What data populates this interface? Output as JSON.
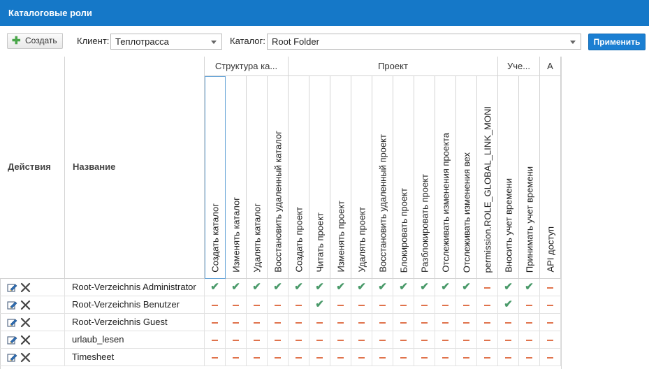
{
  "title": "Каталоговые роли",
  "toolbar": {
    "create_label": "Создать",
    "client_label": "Клиент:",
    "client_value": "Теплотрасса",
    "catalog_label": "Каталог:",
    "catalog_value": "Root Folder",
    "apply_label": "Применить"
  },
  "headers": {
    "actions": "Действия",
    "name": "Название",
    "groups": [
      "Структура ка...",
      "Проект",
      "Уче...",
      "A"
    ],
    "columns": [
      "Создать каталог",
      "Изменять каталог",
      "Удалять каталог",
      "Восстановить удаленный каталог",
      "Создать проект",
      "Читать проект",
      "Изменять проект",
      "Удалять проект",
      "Восстановить удаленный проект",
      "Блокировать проект",
      "Разблокировать проект",
      "Отслеживать изменения проекта",
      "Отслеживать изменения вех",
      "permission.ROLE_GLOBAL_LINK_MONI",
      "Вносить учет времени",
      "Принимать учет времени",
      "API доступ"
    ]
  },
  "rows": [
    {
      "name": "Root-Verzeichnis Administrator",
      "perms": [
        1,
        1,
        1,
        1,
        1,
        1,
        1,
        1,
        1,
        1,
        1,
        1,
        1,
        0,
        1,
        1,
        0
      ]
    },
    {
      "name": "Root-Verzeichnis Benutzer",
      "perms": [
        0,
        0,
        0,
        0,
        0,
        1,
        0,
        0,
        0,
        0,
        0,
        0,
        0,
        0,
        1,
        0,
        0
      ]
    },
    {
      "name": "Root-Verzeichnis Guest",
      "perms": [
        0,
        0,
        0,
        0,
        0,
        0,
        0,
        0,
        0,
        0,
        0,
        0,
        0,
        0,
        0,
        0,
        0
      ]
    },
    {
      "name": "urlaub_lesen",
      "perms": [
        0,
        0,
        0,
        0,
        0,
        0,
        0,
        0,
        0,
        0,
        0,
        0,
        0,
        0,
        0,
        0,
        0
      ]
    },
    {
      "name": "Timesheet",
      "perms": [
        0,
        0,
        0,
        0,
        0,
        0,
        0,
        0,
        0,
        0,
        0,
        0,
        0,
        0,
        0,
        0,
        0
      ]
    }
  ],
  "icons": {
    "edit": "edit-icon",
    "delete": "delete-icon",
    "granted": "check-icon",
    "denied": "dash-icon"
  },
  "colors": {
    "titlebar": "#1578c8",
    "apply": "#1b7fd2",
    "check": "#4a9a6a",
    "dash": "#e0734c"
  }
}
